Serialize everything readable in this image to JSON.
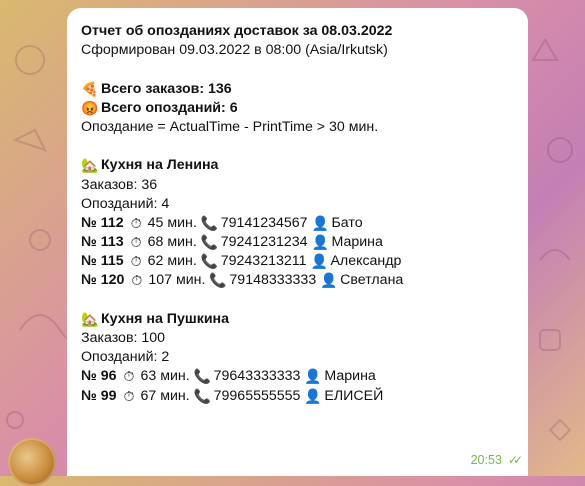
{
  "message": {
    "title": "Отчет об опозданиях доставок за 08.03.2022",
    "generated": "Сформирован 09.03.2022 в 08:00 (Asia/Irkutsk)",
    "total_orders": "Всего заказов: 136",
    "total_late": "Всего опозданий: 6",
    "formula": "Опоздание = ActualTime - PrintTime > 30 мин.",
    "time": "20:53",
    "kitchens": [
      {
        "name": "Кухня на Ленина",
        "orders": "Заказов: 36",
        "late": "Опозданий: 4",
        "rows": [
          {
            "no": "№ 112",
            "min": "45 мин.",
            "phone": "79141234567",
            "name": "Бато"
          },
          {
            "no": "№ 113",
            "min": "68 мин.",
            "phone": "79241231234",
            "name": "Марина"
          },
          {
            "no": "№ 115",
            "min": "62 мин.",
            "phone": "79243213211",
            "name": "Александр"
          },
          {
            "no": "№ 120",
            "min": "107 мин.",
            "phone": "79148333333",
            "name": "Светлана"
          }
        ]
      },
      {
        "name": "Кухня на Пушкина",
        "orders": "Заказов: 100",
        "late": "Опозданий: 2",
        "rows": [
          {
            "no": "№ 96",
            "min": "63 мин.",
            "phone": "79643333333",
            "name": "Марина"
          },
          {
            "no": "№ 99",
            "min": "67 мин.",
            "phone": "79965555555",
            "name": "ЕЛИСЕЙ"
          }
        ]
      }
    ]
  },
  "icons": {
    "pizza": "pizza-icon",
    "angry": "angry-face-icon",
    "kitchen": "house-with-garden-icon",
    "stopwatch": "stopwatch-icon",
    "phone": "phone-icon",
    "person": "person-silhouette-icon",
    "read": "double-check-icon"
  },
  "colors": {
    "bubble": "#ffffff",
    "time_text": "#74b64d"
  }
}
